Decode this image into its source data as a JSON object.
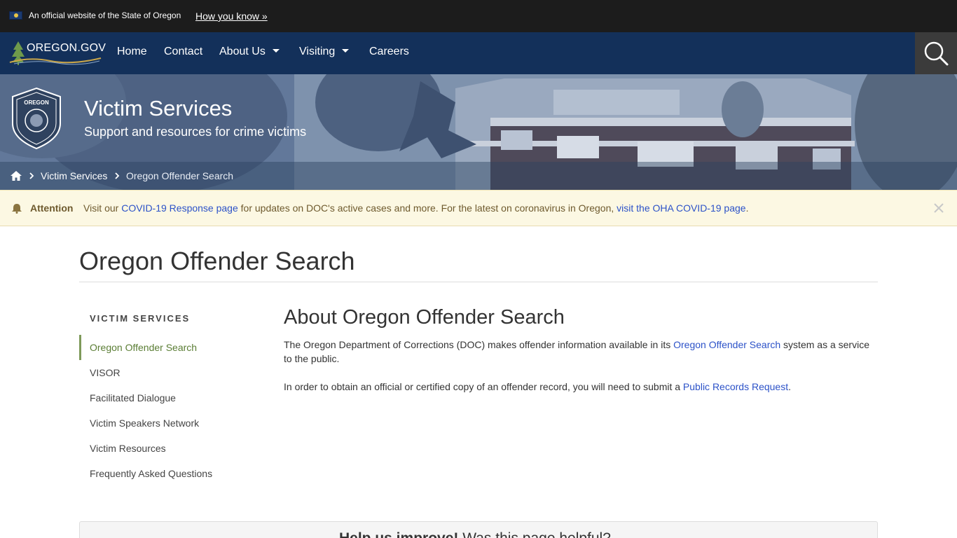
{
  "official_banner": {
    "text": "An official website of the State of Oregon",
    "link": "How you know »"
  },
  "nav": {
    "logo_text": "OREGON.GOV",
    "items": [
      {
        "label": "Home"
      },
      {
        "label": "Contact"
      },
      {
        "label": "About Us",
        "has_dropdown": true
      },
      {
        "label": "Visiting",
        "has_dropdown": true
      },
      {
        "label": "Careers"
      }
    ],
    "search_icon": "search-icon"
  },
  "hero": {
    "title": "Victim Services",
    "subtitle": "Support and resources for crime victims",
    "seal_top": "OREGON",
    "seal_arc": "DEPARTMENT OF CORRECTIONS"
  },
  "breadcrumb": {
    "home_icon": "home-icon",
    "items": [
      "Victim Services",
      "Oregon Offender Search"
    ]
  },
  "alert": {
    "label": "Attention",
    "text_1": "Visit our ",
    "link_1": "COVID-19 Response page",
    "text_2": " for updates on DOC's active cases and more. For the latest on coronavirus in Oregon, ",
    "link_2": "visit the OHA COVID-19 page",
    "text_3": ".",
    "close_icon": "close-icon"
  },
  "page": {
    "title": "Oregon Offender Search"
  },
  "sidebar": {
    "heading": "VICTIM SERVICES",
    "items": [
      {
        "label": "Oregon Offender Search",
        "active": true
      },
      {
        "label": "VISOR"
      },
      {
        "label": "Facilitated Dialogue"
      },
      {
        "label": "Victim Speakers Network"
      },
      {
        "label": "Victim Resources"
      },
      {
        "label": "Frequently Asked Questions"
      }
    ]
  },
  "content": {
    "title": "About Oregon Offender Search",
    "p1_a": "The Oregon Department of Corrections (DOC) makes offender information available in its ",
    "p1_link": "Oregon Offender Search",
    "p1_b": " system as a service to the public.",
    "p2_a": "In order to obtain an official or certified copy of an offender record, you will need to submit a ",
    "p2_link": "Public Records Request",
    "p2_b": "."
  },
  "feedback": {
    "bold": "Help us improve!",
    "question": " Was this page helpful?"
  },
  "colors": {
    "nav_bg": "#13305a",
    "link": "#2c52c8",
    "active_side": "#5a7d34",
    "alert_bg": "#fcf8e3"
  }
}
